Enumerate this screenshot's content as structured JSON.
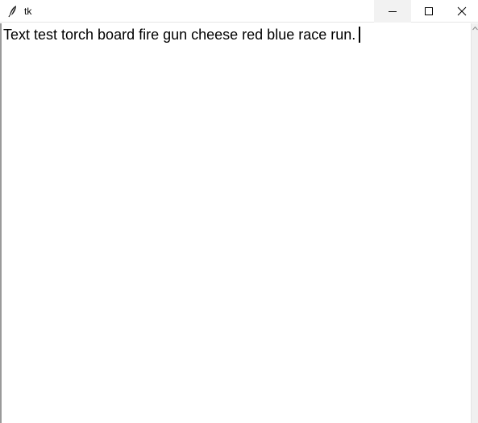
{
  "window": {
    "title": "tk",
    "controls": {
      "minimize_icon": "minimize-icon",
      "maximize_icon": "maximize-icon",
      "close_icon": "close-icon"
    }
  },
  "editor": {
    "text": "Text test torch board fire gun cheese red blue race run."
  },
  "colors": {
    "titlebar_bg": "#ffffff",
    "minimize_hover_bg": "#f2f2f2",
    "text": "#000000",
    "scrollbar_bg": "#f0f0f0"
  }
}
